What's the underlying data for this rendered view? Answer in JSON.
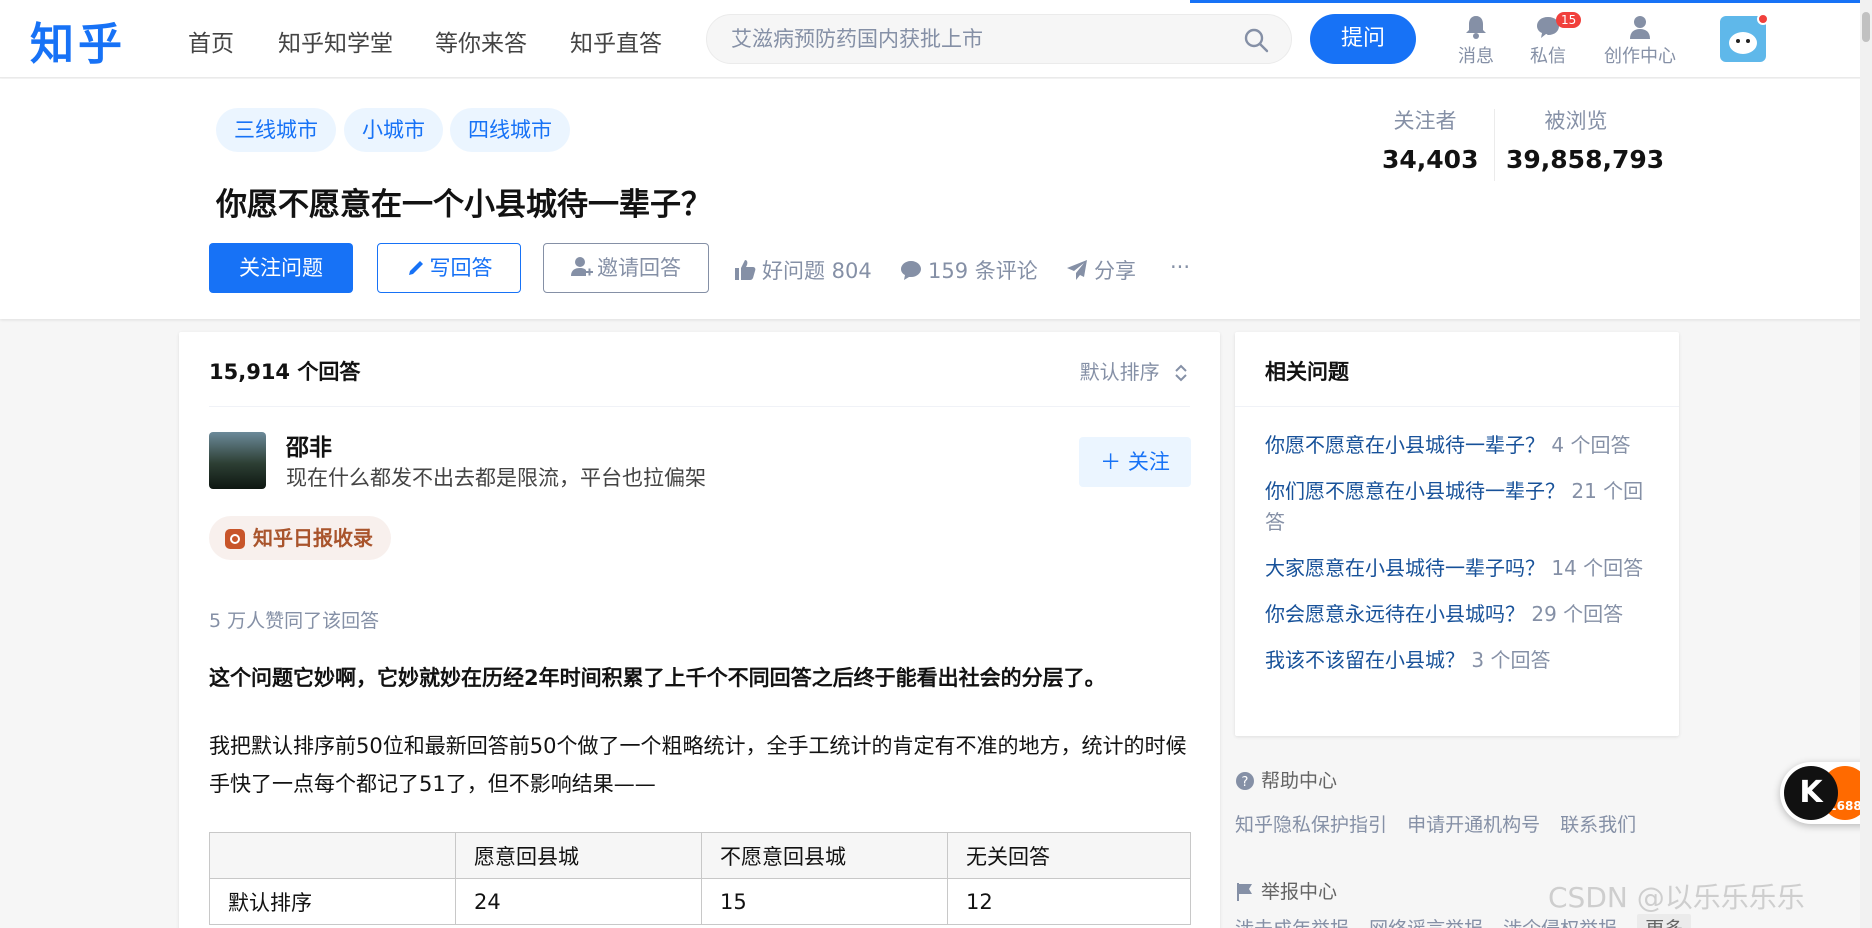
{
  "nav": {
    "logo": "知乎",
    "items": [
      "首页",
      "知乎知学堂",
      "等你来答",
      "知乎直答"
    ],
    "search_placeholder": "艾滋病预防药国内获批上市",
    "ask_label": "提问",
    "icons": [
      {
        "label": "消息",
        "icon": "bell-icon"
      },
      {
        "label": "私信",
        "icon": "chat-icon",
        "badge": "15"
      },
      {
        "label": "创作中心",
        "icon": "creator-icon"
      }
    ]
  },
  "question": {
    "tags": [
      "三线城市",
      "小城市",
      "四线城市"
    ],
    "title": "你愿不愿意在一个小县城待一辈子？",
    "follow_label": "关注问题",
    "write_label": "写回答",
    "invite_label": "邀请回答",
    "good_question": "好问题 804",
    "comments": "159 条评论",
    "share": "分享",
    "more": "···",
    "stats": {
      "followers_label": "关注者",
      "followers": "34,403",
      "views_label": "被浏览",
      "views": "39,858,793"
    }
  },
  "answers": {
    "count": "15,914 个回答",
    "sort": "默认排序",
    "author": {
      "name": "邵非",
      "bio": "现在什么都发不出去都是限流，平台也拉偏架",
      "follow": "关注"
    },
    "badge": "知乎日报收录",
    "votes": "5 万人赞同了该回答",
    "bold_paragraph": "这个问题它妙啊，它妙就妙在历经2年时间积累了上千个不同回答之后终于能看出社会的分层了。",
    "paragraph": "我把默认排序前50位和最新回答前50个做了一个粗略统计，全手工统计的肯定有不准的地方，统计的时候手快了一点每个都记了51了，但不影响结果——",
    "table": {
      "headers": [
        "",
        "愿意回县城",
        "不愿意回县城",
        "无关回答"
      ],
      "rows": [
        [
          "默认排序",
          "24",
          "15",
          "12"
        ]
      ]
    }
  },
  "sidebar": {
    "related_title": "相关问题",
    "related": [
      {
        "q": "你愿不愿意在小县城待一辈子？",
        "c": "4 个回答"
      },
      {
        "q": "你们愿不愿意在小县城待一辈子？",
        "c": "21 个回答"
      },
      {
        "q": "大家愿意在小县城待一辈子吗？",
        "c": "14 个回答"
      },
      {
        "q": "你会愿意永远待在小县城吗？",
        "c": "29 个回答"
      },
      {
        "q": "我该不该留在小县城？",
        "c": "3 个回答"
      }
    ],
    "help_center": "帮助中心",
    "help_links": [
      "知乎隐私保护指引",
      "申请开通机构号",
      "联系我们"
    ],
    "report_center": "举报中心",
    "report_links": [
      "涉未成年举报",
      "网络谣言举报",
      "涉企侵权举报"
    ],
    "more": "更多"
  },
  "watermark": "CSDN @以乐乐乐乐",
  "colors": {
    "brand": "#1772f6",
    "link": "#175199",
    "muted": "#8590a6"
  }
}
